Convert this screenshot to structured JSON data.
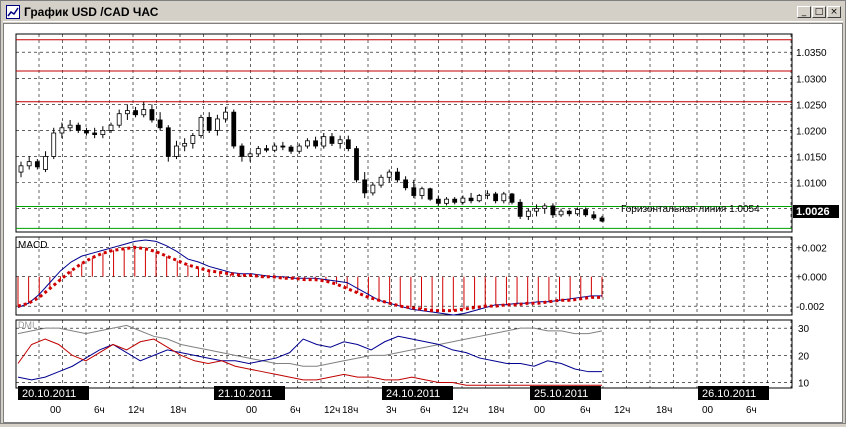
{
  "window": {
    "title": "График USD /CAD  ЧАС",
    "minimize_label": "_",
    "maximize_label": "□",
    "close_label": "×"
  },
  "main_panel": {
    "price_ticks": [
      "1.0350",
      "1.0300",
      "1.0250",
      "1.0200",
      "1.0150",
      "1.0100",
      "1.0050"
    ],
    "current_price": "1.0026",
    "horizontal_line_label": "Горизонтальная линия 1.0054",
    "horizontal_line_value": 1.0054,
    "resistance_lines": [
      1.0374,
      1.0314,
      1.0255
    ],
    "line_colors": {
      "resistance": "#c00000",
      "horizontal": "#00a000",
      "grid": "#000000"
    }
  },
  "macd_panel": {
    "label": "MACD",
    "ticks": [
      "+0.002",
      "+0.000",
      "-0.002"
    ],
    "colors": {
      "main": "#000090",
      "signal": "#d00000",
      "histogram": "#d00000"
    }
  },
  "dmi_panel": {
    "label": "DMI",
    "ticks": [
      "30",
      "20",
      "10"
    ],
    "colors": {
      "adx": "#808080",
      "plus_di": "#000090",
      "minus_di": "#c00000"
    }
  },
  "time_axis": {
    "date_labels": [
      "20.10.2011",
      "21.10.2011",
      "24.10.2011",
      "25.10.2011",
      "26.10.2011"
    ],
    "hour_labels": [
      "00",
      "6ч",
      "12ч",
      "18ч",
      "00",
      "6ч",
      "12ч",
      "18ч",
      "3ч",
      "6ч",
      "12ч",
      "18ч",
      "00",
      "6ч",
      "12ч",
      "18ч",
      "00",
      "6ч"
    ]
  },
  "chart_data": [
    {
      "type": "candlestick",
      "title": "",
      "ylim": [
        1.0005,
        1.0385
      ],
      "y_ticks": [
        1.035,
        1.03,
        1.025,
        1.02,
        1.015,
        1.01,
        1.005
      ],
      "ohlc": [
        [
          1.012,
          1.014,
          1.011,
          1.0132
        ],
        [
          1.0132,
          1.015,
          1.0125,
          1.014
        ],
        [
          1.014,
          1.0145,
          1.0125,
          1.013
        ],
        [
          1.0125,
          1.016,
          1.012,
          1.015
        ],
        [
          1.015,
          1.0205,
          1.0145,
          1.0195
        ],
        [
          1.0195,
          1.0215,
          1.0185,
          1.0205
        ],
        [
          1.0205,
          1.022,
          1.0198,
          1.021
        ],
        [
          1.021,
          1.0215,
          1.0195,
          1.02
        ],
        [
          1.02,
          1.0205,
          1.019,
          1.0195
        ],
        [
          1.0195,
          1.0205,
          1.0185,
          1.0192
        ],
        [
          1.0192,
          1.0208,
          1.0185,
          1.02
        ],
        [
          1.02,
          1.0215,
          1.0195,
          1.021
        ],
        [
          1.021,
          1.024,
          1.0205,
          1.0232
        ],
        [
          1.0232,
          1.025,
          1.022,
          1.0238
        ],
        [
          1.0238,
          1.0245,
          1.0225,
          1.023
        ],
        [
          1.023,
          1.0255,
          1.0225,
          1.024
        ],
        [
          1.024,
          1.025,
          1.0215,
          1.022
        ],
        [
          1.022,
          1.0235,
          1.02,
          1.0205
        ],
        [
          1.0205,
          1.021,
          1.014,
          1.015
        ],
        [
          1.015,
          1.018,
          1.0145,
          1.017
        ],
        [
          1.017,
          1.0185,
          1.016,
          1.0175
        ],
        [
          1.0175,
          1.0195,
          1.0165,
          1.019
        ],
        [
          1.019,
          1.023,
          1.0185,
          1.0225
        ],
        [
          1.0225,
          1.0235,
          1.0195,
          1.02
        ],
        [
          1.02,
          1.023,
          1.019,
          1.0222
        ],
        [
          1.0222,
          1.0245,
          1.0215,
          1.0235
        ],
        [
          1.0235,
          1.024,
          1.0165,
          1.017
        ],
        [
          1.017,
          1.0175,
          1.014,
          1.015
        ],
        [
          1.015,
          1.016,
          1.014,
          1.0155
        ],
        [
          1.0155,
          1.017,
          1.015,
          1.0165
        ],
        [
          1.0165,
          1.0172,
          1.0158,
          1.0162
        ],
        [
          1.0162,
          1.0175,
          1.0158,
          1.017
        ],
        [
          1.017,
          1.0178,
          1.0162,
          1.0168
        ],
        [
          1.0168,
          1.0172,
          1.0155,
          1.016
        ],
        [
          1.016,
          1.0175,
          1.0155,
          1.017
        ],
        [
          1.017,
          1.0185,
          1.0165,
          1.018
        ],
        [
          1.018,
          1.0188,
          1.0165,
          1.017
        ],
        [
          1.017,
          1.0195,
          1.0165,
          1.0188
        ],
        [
          1.0188,
          1.0195,
          1.017,
          1.0175
        ],
        [
          1.0175,
          1.019,
          1.0165,
          1.0182
        ],
        [
          1.0182,
          1.019,
          1.016,
          1.0165
        ],
        [
          1.0165,
          1.017,
          1.01,
          1.0105
        ],
        [
          1.0105,
          1.012,
          1.007,
          1.008
        ],
        [
          1.008,
          1.01,
          1.0075,
          1.0095
        ],
        [
          1.0095,
          1.0115,
          1.009,
          1.011
        ],
        [
          1.011,
          1.0125,
          1.01,
          1.012
        ],
        [
          1.012,
          1.0128,
          1.01,
          1.0105
        ],
        [
          1.0105,
          1.0112,
          1.0085,
          1.009
        ],
        [
          1.009,
          1.0105,
          1.007,
          1.0075
        ],
        [
          1.0075,
          1.0092,
          1.0068,
          1.0088
        ],
        [
          1.0088,
          1.009,
          1.0065,
          1.0068
        ],
        [
          1.0068,
          1.0075,
          1.0055,
          1.006
        ],
        [
          1.006,
          1.0072,
          1.0056,
          1.0068
        ],
        [
          1.0068,
          1.0072,
          1.0058,
          1.0062
        ],
        [
          1.0062,
          1.0075,
          1.0058,
          1.007
        ],
        [
          1.007,
          1.008,
          1.006,
          1.0065
        ],
        [
          1.0065,
          1.0078,
          1.0062,
          1.0075
        ],
        [
          1.0075,
          1.0085,
          1.0068,
          1.0078
        ],
        [
          1.0078,
          1.0082,
          1.006,
          1.0065
        ],
        [
          1.0065,
          1.0082,
          1.006,
          1.0078
        ],
        [
          1.0078,
          1.008,
          1.0058,
          1.0062
        ],
        [
          1.0062,
          1.0068,
          1.003,
          1.0035
        ],
        [
          1.0035,
          1.005,
          1.0028,
          1.0045
        ],
        [
          1.0045,
          1.0058,
          1.0035,
          1.005
        ],
        [
          1.005,
          1.006,
          1.004,
          1.0055
        ],
        [
          1.0055,
          1.006,
          1.0032,
          1.0038
        ],
        [
          1.0038,
          1.005,
          1.0034,
          1.0045
        ],
        [
          1.0045,
          1.0048,
          1.0035,
          1.004
        ],
        [
          1.004,
          1.0052,
          1.0036,
          1.0048
        ],
        [
          1.0048,
          1.0052,
          1.0034,
          1.0038
        ],
        [
          1.0038,
          1.0045,
          1.0028,
          1.0032
        ],
        [
          1.0032,
          1.0036,
          1.0024,
          1.0026
        ]
      ],
      "series": [
        {
          "values": [
            1.0374,
            1.0374
          ]
        },
        {
          "values": [
            1.0314,
            1.0314
          ]
        },
        {
          "values": [
            1.0255,
            1.0255
          ]
        },
        {
          "name": "Горизонтальная линия 1.0054",
          "values": [
            1.0054,
            1.0054
          ]
        }
      ],
      "grid": true
    },
    {
      "type": "line",
      "title": "MACD",
      "ylim": [
        -0.0026,
        0.0027
      ],
      "y_ticks": [
        0.002,
        0.0,
        -0.002
      ],
      "series": [
        {
          "values": [
            -0.0021,
            -0.0018,
            -0.0012,
            -0.0004,
            0.0004,
            0.001,
            0.0014,
            0.0016,
            0.0018,
            0.002,
            0.0022,
            0.0024,
            0.0025,
            0.0024,
            0.0021,
            0.0017,
            0.0012,
            0.001,
            0.0007,
            0.0005,
            0.0003,
            0.0002,
            0.0002,
            0.0001,
            0.0,
            0.0,
            -0.0001,
            -0.0001,
            -0.0001,
            -0.0002,
            -0.0003,
            -0.0004,
            -0.0008,
            -0.0012,
            -0.0016,
            -0.0018,
            -0.002,
            -0.0022,
            -0.0023,
            -0.0024,
            -0.0025,
            -0.0026,
            -0.0025,
            -0.0023,
            -0.0021,
            -0.0019,
            -0.0019,
            -0.0018,
            -0.0018,
            -0.0017,
            -0.0017,
            -0.0016,
            -0.0015,
            -0.0014,
            -0.0013,
            -0.0013
          ]
        },
        {
          "values": [
            -0.002,
            -0.0018,
            -0.0014,
            -0.0008,
            -0.0002,
            0.0004,
            0.0009,
            0.0013,
            0.0016,
            0.0018,
            0.0019,
            0.002,
            0.0019,
            0.0017,
            0.0014,
            0.0011,
            0.0008,
            0.0006,
            0.0004,
            0.0003,
            0.0002,
            0.0001,
            0.0001,
            0.0,
            -0.0,
            -0.0001,
            -0.0001,
            -0.0002,
            -0.0002,
            -0.0003,
            -0.0005,
            -0.0008,
            -0.0011,
            -0.0014,
            -0.0016,
            -0.0018,
            -0.002,
            -0.0021,
            -0.0022,
            -0.0023,
            -0.0023,
            -0.0023,
            -0.0022,
            -0.0021,
            -0.002,
            -0.002,
            -0.0019,
            -0.0019,
            -0.0018,
            -0.0018,
            -0.0017,
            -0.0016,
            -0.0016,
            -0.0015,
            -0.0014,
            -0.0014
          ]
        }
      ],
      "grid": true
    },
    {
      "type": "line",
      "title": "DMI",
      "ylim": [
        8,
        33
      ],
      "y_ticks": [
        30,
        20,
        10
      ],
      "series": [
        {
          "values": [
            28,
            29,
            30,
            30,
            29,
            28,
            29,
            30,
            31,
            29,
            27,
            26,
            24,
            23,
            22,
            21,
            20,
            19,
            18,
            17,
            17,
            16,
            16,
            17,
            18,
            19,
            20,
            20,
            21,
            22,
            23,
            24,
            25,
            26,
            27,
            28,
            29,
            30,
            30,
            29,
            29,
            28,
            28,
            29
          ]
        },
        {
          "values": [
            12,
            11,
            12,
            14,
            16,
            19,
            22,
            24,
            21,
            18,
            20,
            22,
            21,
            20,
            19,
            18,
            18,
            17,
            18,
            19,
            21,
            26,
            24,
            23,
            25,
            24,
            22,
            25,
            27,
            26,
            25,
            24,
            22,
            21,
            19,
            18,
            17,
            17,
            16,
            18,
            17,
            15,
            14,
            14
          ]
        },
        {
          "values": [
            17,
            24,
            26,
            24,
            20,
            18,
            21,
            24,
            22,
            25,
            26,
            23,
            20,
            18,
            17,
            18,
            16,
            15,
            14,
            13,
            12,
            11,
            11,
            12,
            13,
            12,
            12,
            11,
            11,
            12,
            11,
            10,
            10,
            9,
            9,
            9,
            9,
            9,
            9,
            9,
            9,
            9,
            9,
            9
          ]
        }
      ],
      "grid": true
    }
  ]
}
